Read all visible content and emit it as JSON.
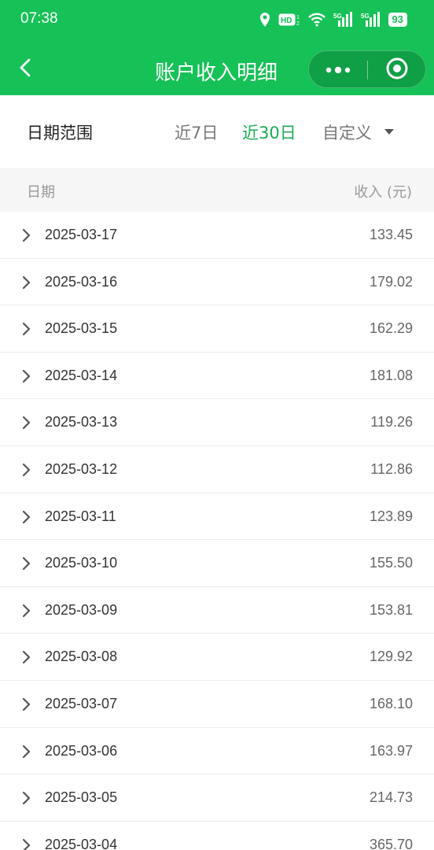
{
  "status_bar": {
    "time": "07:38",
    "icons": [
      "location-icon",
      "hd-icon",
      "wifi-icon",
      "signal-5g-icon",
      "signal-5g-icon"
    ],
    "battery": "93"
  },
  "nav": {
    "title": "账户收入明细",
    "back_icon": "chevron-left-icon",
    "more_icon": "more-dots-icon",
    "close_icon": "target-circle-icon"
  },
  "filter": {
    "label": "日期范围",
    "options": [
      "近7日",
      "近30日",
      "自定义"
    ],
    "selected": "近30日"
  },
  "table": {
    "header_date": "日期",
    "header_amount": "收入 (元)",
    "rows": [
      {
        "date": "2025-03-17",
        "amount": "133.45"
      },
      {
        "date": "2025-03-16",
        "amount": "179.02"
      },
      {
        "date": "2025-03-15",
        "amount": "162.29"
      },
      {
        "date": "2025-03-14",
        "amount": "181.08"
      },
      {
        "date": "2025-03-13",
        "amount": "119.26"
      },
      {
        "date": "2025-03-12",
        "amount": "112.86"
      },
      {
        "date": "2025-03-11",
        "amount": "123.89"
      },
      {
        "date": "2025-03-10",
        "amount": "155.50"
      },
      {
        "date": "2025-03-09",
        "amount": "153.81"
      },
      {
        "date": "2025-03-08",
        "amount": "129.92"
      },
      {
        "date": "2025-03-07",
        "amount": "168.10"
      },
      {
        "date": "2025-03-06",
        "amount": "163.97"
      },
      {
        "date": "2025-03-05",
        "amount": "214.73"
      },
      {
        "date": "2025-03-04",
        "amount": "365.70"
      }
    ]
  },
  "colors": {
    "brand": "#16c157",
    "selected_option": "#1aad54"
  }
}
